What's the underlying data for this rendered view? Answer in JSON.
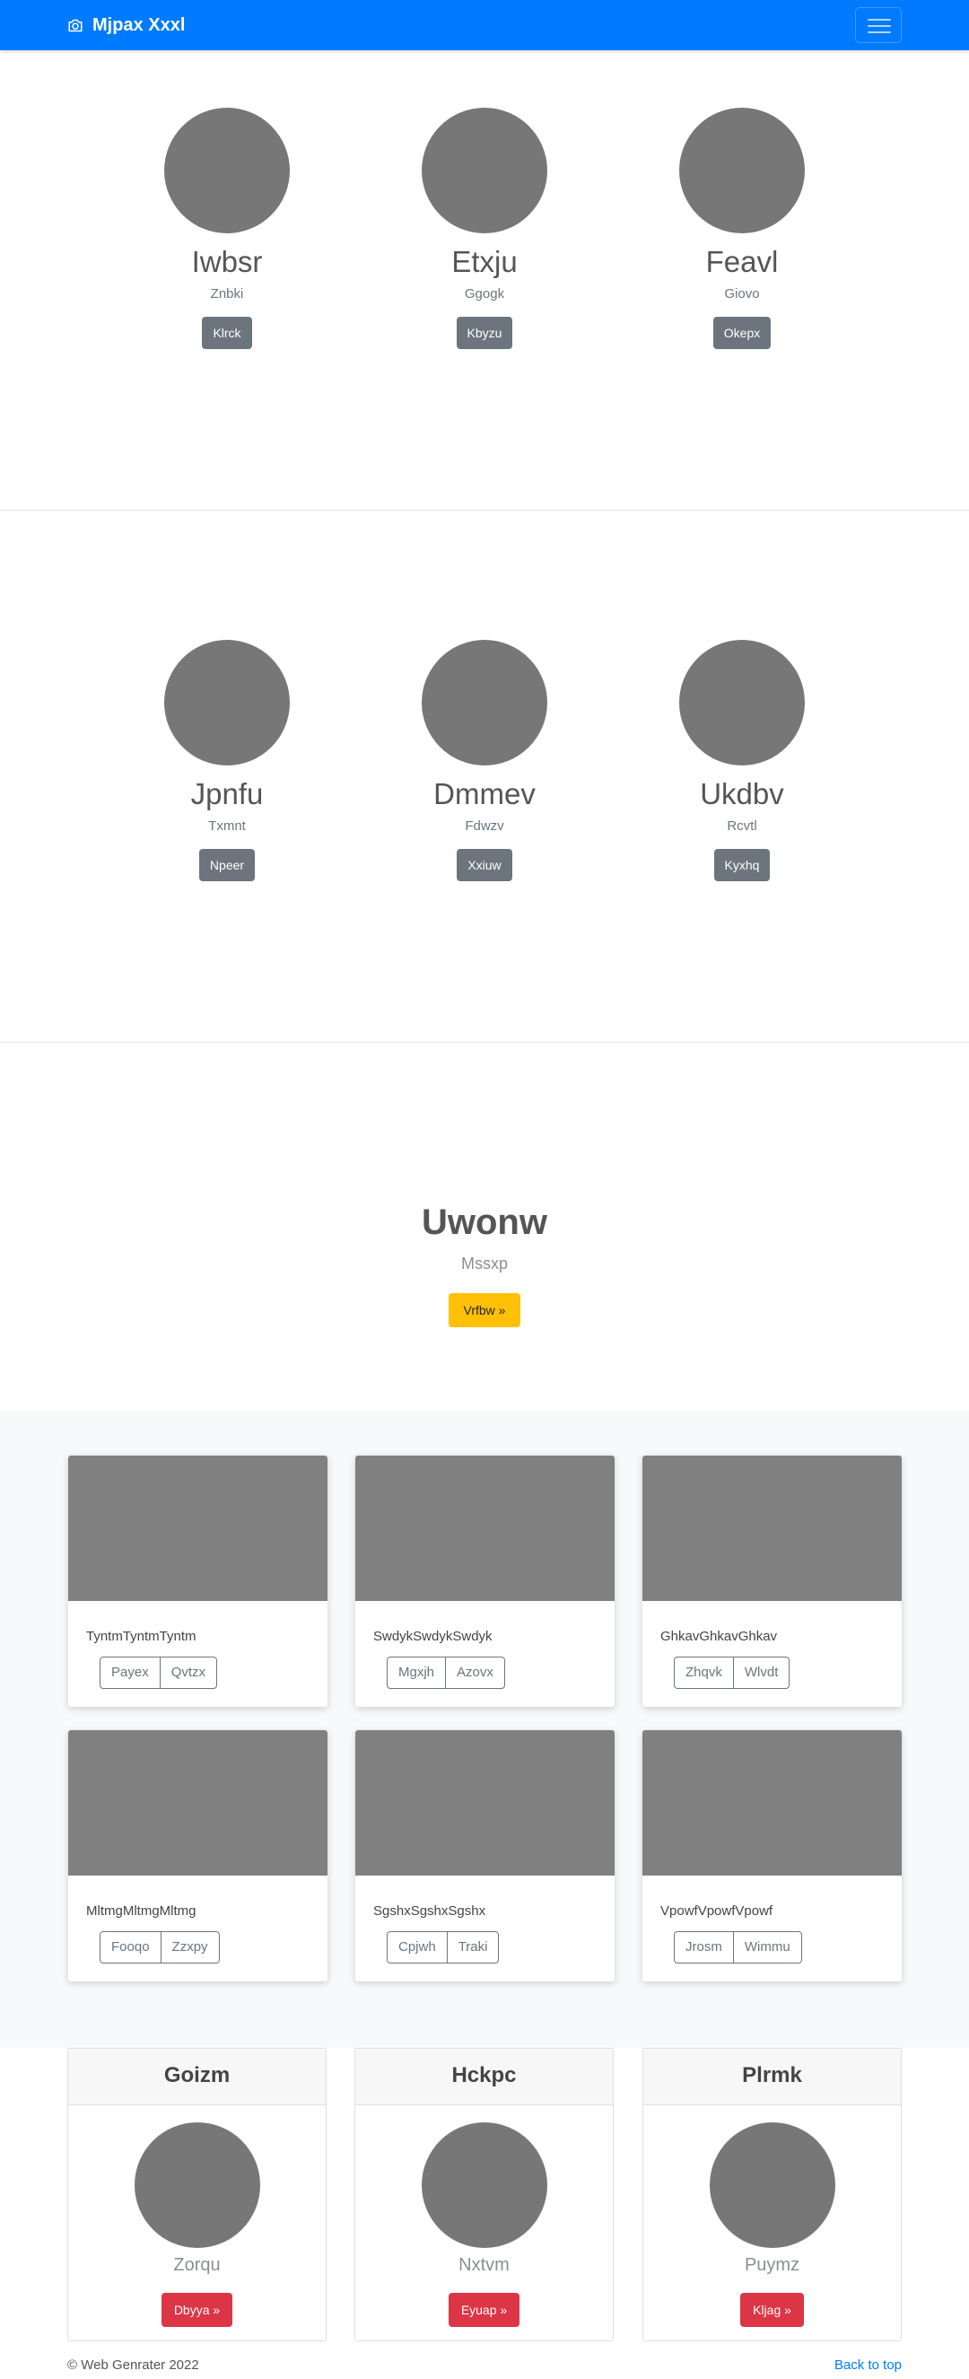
{
  "navbar": {
    "brand": "Mjpax Xxxl",
    "brand_icon": "camera-icon",
    "toggle_icon": "hamburger-icon"
  },
  "people_row1": [
    {
      "name": "Iwbsr",
      "sub": "Znbki",
      "button": "Klrck"
    },
    {
      "name": "Etxju",
      "sub": "Ggogk",
      "button": "Kbyzu"
    },
    {
      "name": "Feavl",
      "sub": "Giovo",
      "button": "Okepx"
    }
  ],
  "people_row2": [
    {
      "name": "Jpnfu",
      "sub": "Txmnt",
      "button": "Npeer"
    },
    {
      "name": "Dmmev",
      "sub": "Fdwzv",
      "button": "Xxiuw"
    },
    {
      "name": "Ukdbv",
      "sub": "Rcvtl",
      "button": "Kyxhq"
    }
  ],
  "hero": {
    "title": "Uwonw",
    "subtitle": "Mssxp",
    "button": "Vrfbw »"
  },
  "album": [
    {
      "text": "TyntmTyntmTyntm",
      "btn1": "Payex",
      "btn2": "Qvtzx"
    },
    {
      "text": "SwdykSwdykSwdyk",
      "btn1": "Mgxjh",
      "btn2": "Azovx"
    },
    {
      "text": "GhkavGhkavGhkav",
      "btn1": "Zhqvk",
      "btn2": "Wlvdt"
    },
    {
      "text": "MltmgMltmgMltmg",
      "btn1": "Fooqo",
      "btn2": "Zzxpy"
    },
    {
      "text": "SgshxSgshxSgshx",
      "btn1": "Cpjwh",
      "btn2": "Traki"
    },
    {
      "text": "VpowfVpowfVpowf",
      "btn1": "Jrosm",
      "btn2": "Wimmu"
    }
  ],
  "cards": [
    {
      "header": "Goizm",
      "sub": "Zorqu",
      "button": "Dbyya »"
    },
    {
      "header": "Hckpc",
      "sub": "Nxtvm",
      "button": "Eyuap »"
    },
    {
      "header": "Plrmk",
      "sub": "Puymz",
      "button": "Kljag »"
    }
  ],
  "footer": {
    "copyright": "© Web Genrater 2022",
    "back_to_top": "Back to top"
  },
  "colors": {
    "primary": "#007bff",
    "secondary": "#6c757d",
    "warning": "#ffc107",
    "danger": "#dc3545"
  }
}
